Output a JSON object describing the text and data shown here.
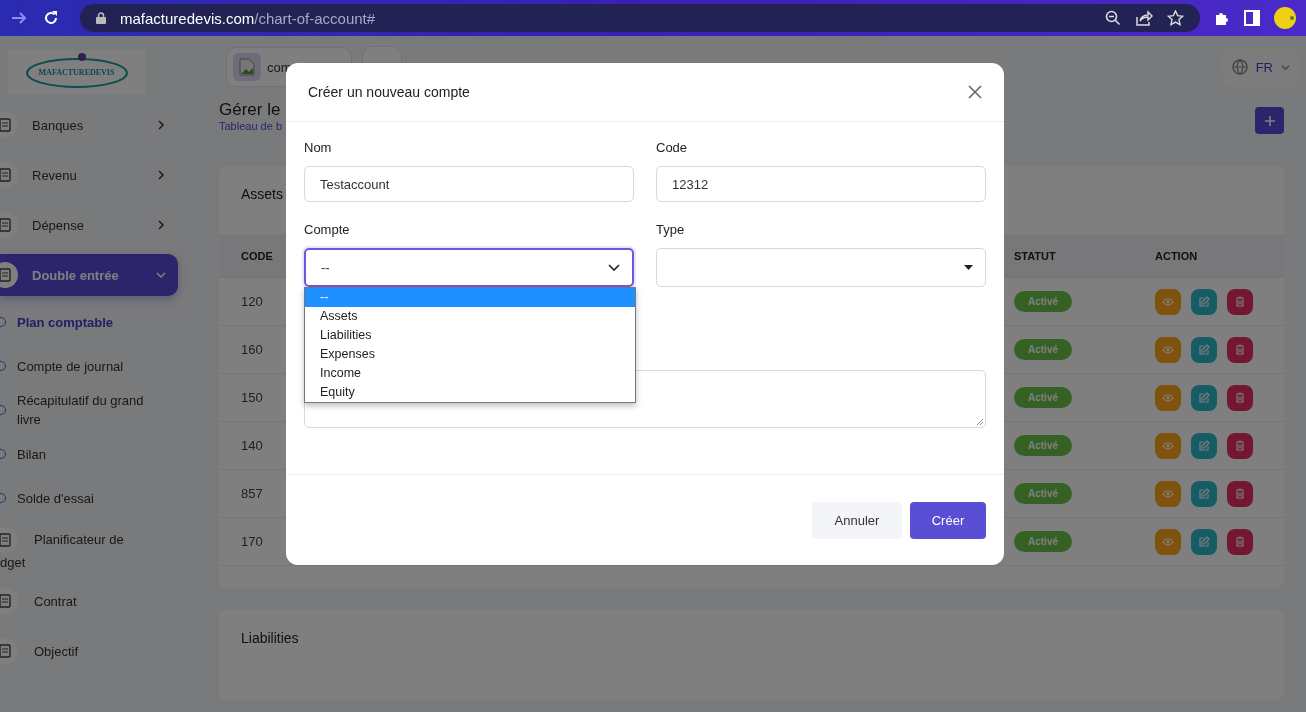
{
  "browser": {
    "url_host": "mafacturedevis.com",
    "url_path": "/chart-of-account#"
  },
  "logo": {
    "text": "MAFACTUREDEVIS"
  },
  "header": {
    "company": "com",
    "language": "FR"
  },
  "sidebar": {
    "items": [
      {
        "label": "Banques",
        "kind": "group",
        "selected": false,
        "expanded": false
      },
      {
        "label": "Revenu",
        "kind": "group",
        "selected": false,
        "expanded": false
      },
      {
        "label": "Dépense",
        "kind": "group",
        "selected": false,
        "expanded": false
      },
      {
        "label": "Double entrée",
        "kind": "group",
        "selected": true,
        "expanded": true
      },
      {
        "label": "Plan comptable",
        "kind": "sub",
        "selected": true
      },
      {
        "label": "Compte de journal",
        "kind": "sub",
        "selected": false
      },
      {
        "label": "Récapitulatif du grand livre",
        "kind": "sub",
        "selected": false
      },
      {
        "label": "Bilan",
        "kind": "sub",
        "selected": false
      },
      {
        "label": "Solde d'essai",
        "kind": "sub",
        "selected": false
      },
      {
        "label": "Planificateur de",
        "continuation": "dget",
        "kind": "plain"
      },
      {
        "label": "Contrat",
        "kind": "plain"
      },
      {
        "label": "Objectif",
        "kind": "plain"
      }
    ]
  },
  "page": {
    "title": "Gérer le",
    "breadcrumb": "Tableau de b"
  },
  "assets_card": {
    "title": "Assets",
    "columns": [
      "CODE",
      "STATUT",
      "ACTION"
    ],
    "rows": [
      {
        "code": "120",
        "status": "Activé"
      },
      {
        "code": "160",
        "status": "Activé"
      },
      {
        "code": "150",
        "status": "Activé"
      },
      {
        "code": "140",
        "status": "Activé"
      },
      {
        "code": "857",
        "status": "Activé"
      },
      {
        "code": "170",
        "status": "Activé"
      }
    ]
  },
  "liabilities_card": {
    "title": "Liabilities"
  },
  "modal": {
    "title": "Créer un nouveau compte",
    "fields": [
      {
        "label": "Nom",
        "value": "Testaccount",
        "kind": "input"
      },
      {
        "label": "Code",
        "value": "12312",
        "kind": "input"
      },
      {
        "label": "Compte",
        "value": "--",
        "kind": "select",
        "focused": true,
        "expanded": true
      },
      {
        "label": "Type",
        "kind": "select",
        "focused": false,
        "expanded": false
      }
    ],
    "options": [
      {
        "label": "--",
        "selected": true
      },
      {
        "label": "Assets",
        "selected": false
      },
      {
        "label": "Liabilities",
        "selected": false
      },
      {
        "label": "Expenses",
        "selected": false
      },
      {
        "label": "Income",
        "selected": false
      },
      {
        "label": "Equity",
        "selected": false
      }
    ],
    "buttons": {
      "cancel": "Annuler",
      "submit": "Créer"
    }
  }
}
